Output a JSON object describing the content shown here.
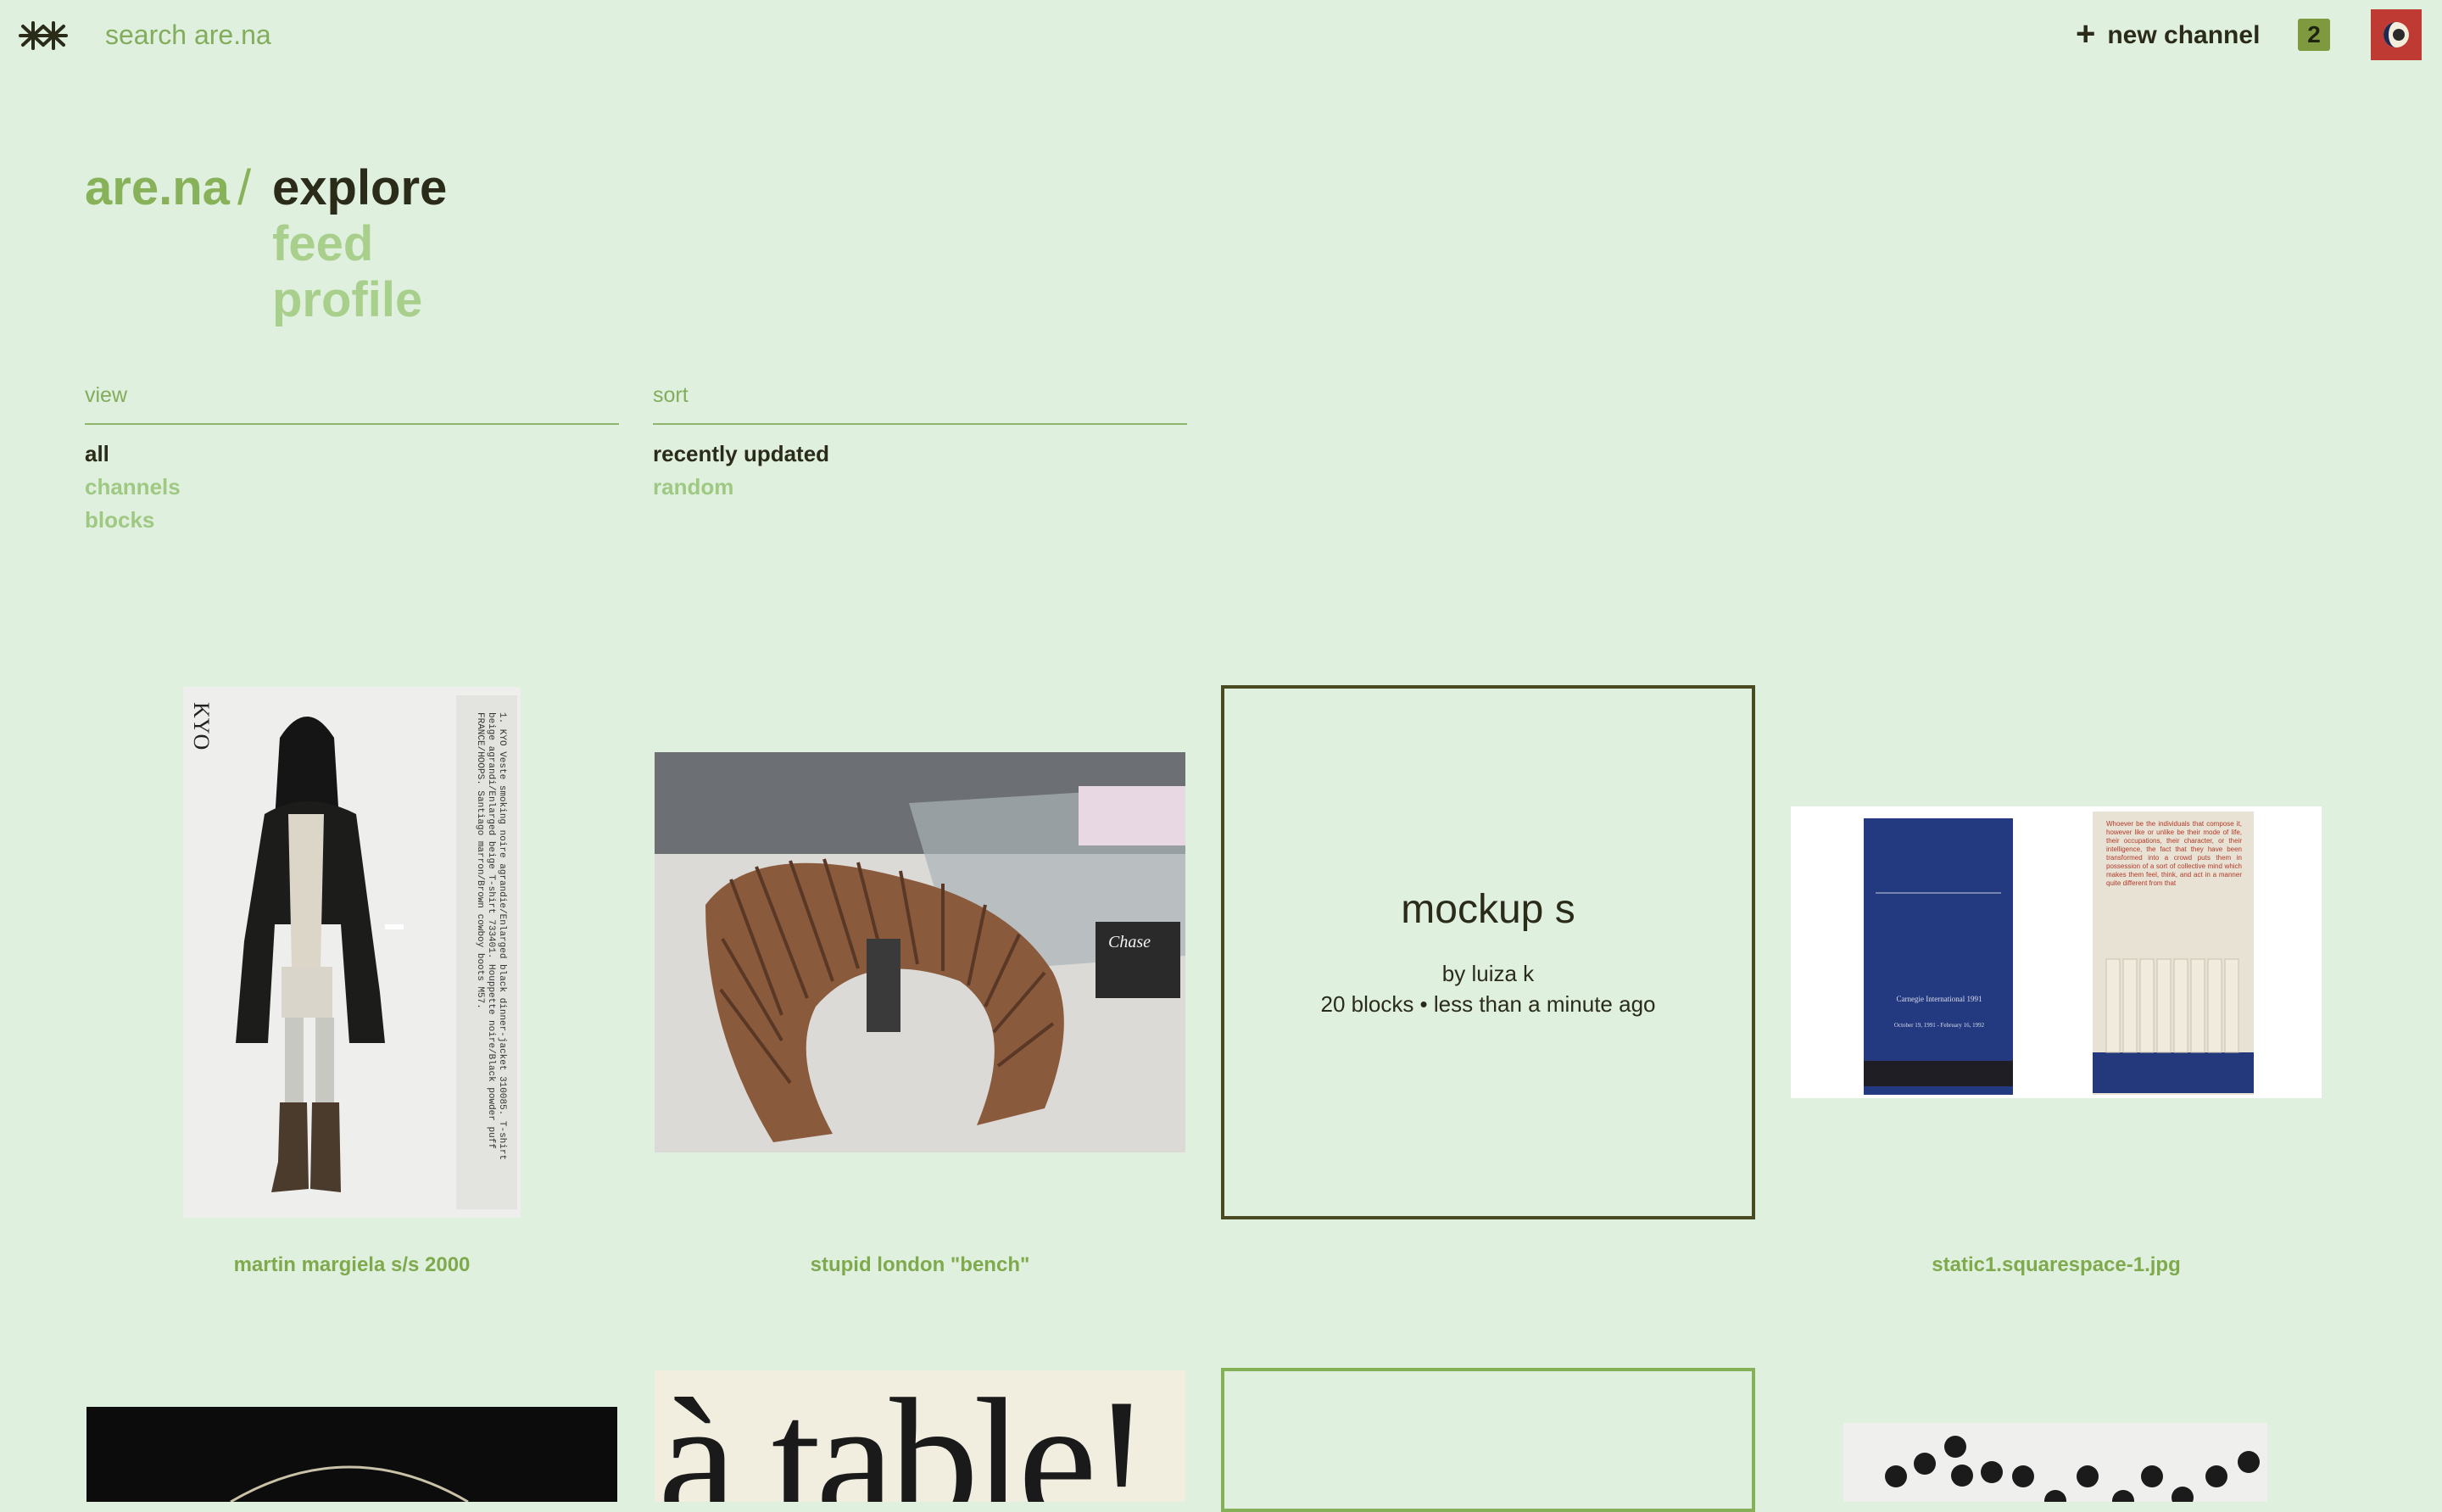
{
  "header": {
    "search_placeholder": "search are.na",
    "new_channel_plus": "+",
    "new_channel_label": "new channel",
    "notification_count": "2",
    "logo_icon": "arena-asterisk-logo-icon",
    "avatar_icon": "moon-avatar-icon"
  },
  "breadcrumb": {
    "root": "are.na",
    "separator": "/",
    "current": "explore",
    "alternatives": [
      "feed",
      "profile"
    ]
  },
  "filters": {
    "view": {
      "label": "view",
      "options": [
        "all",
        "channels",
        "blocks"
      ],
      "selected": "all"
    },
    "sort": {
      "label": "sort",
      "options": [
        "recently updated",
        "random"
      ],
      "selected": "recently updated"
    }
  },
  "grid": {
    "row1": [
      {
        "type": "image",
        "caption": "martin margiela s/s 2000",
        "image_label": "KYO",
        "image_text": "1. KYO  Veste smoking noire agrandie/Enlarged black dinner-jacket 310085. T-shirt beige agrandi/Enlarged beige T-shirt 733401. Houppette noire/Black powder puff FRANCE/HOOPS. Santiago marron/Brown cowboy boots M57."
      },
      {
        "type": "image",
        "caption": "stupid london \"bench\""
      },
      {
        "type": "channel",
        "title": "mockup s",
        "author": "by luiza k",
        "meta": "20 blocks • less than a minute ago"
      },
      {
        "type": "image",
        "caption": "static1.squarespace-1.jpg",
        "image_text_left": "Carnegie International 1991",
        "image_text_left_dates": "October 19, 1991 - February 16, 1992",
        "image_text_right": "Whoever be the individuals that compose it, however like or unlike be their mode of life, their occupations, their character, or their intelligence, the fact that they have been transformed into a crowd puts them in possession of a sort of collective mind which makes them feel, think, and act in a manner quite different from that"
      }
    ],
    "row2": [
      {
        "type": "image"
      },
      {
        "type": "image",
        "image_text": "à table!"
      },
      {
        "type": "channel"
      },
      {
        "type": "image"
      }
    ]
  },
  "colors": {
    "background": "#dff0de",
    "accent": "#87b25a",
    "text": "#2b2b1a",
    "channel_border": "#4a4a22",
    "notification": "#7f9a3e",
    "avatar": "#c03a34"
  }
}
